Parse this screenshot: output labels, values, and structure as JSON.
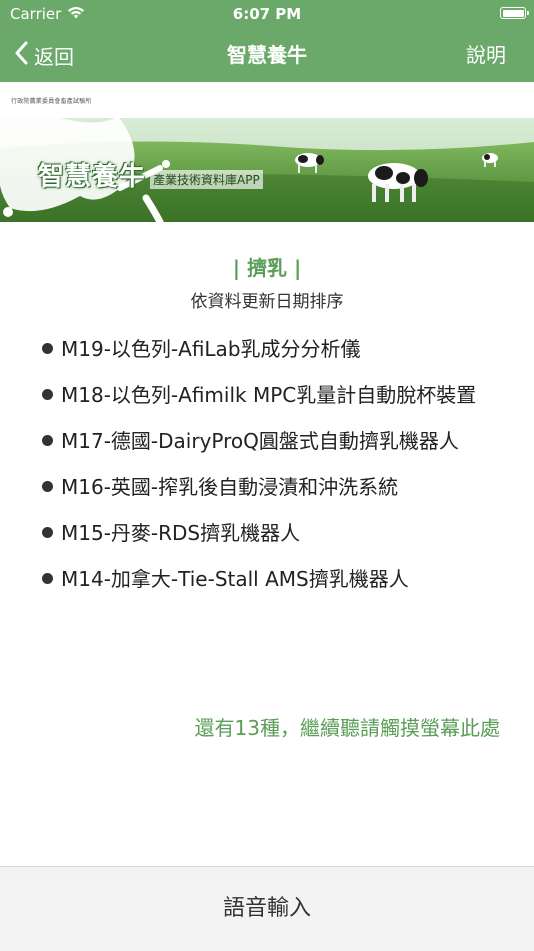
{
  "status_bar": {
    "carrier": "Carrier",
    "time": "6:07 PM",
    "icons": [
      "wifi-icon",
      "battery-icon"
    ]
  },
  "nav": {
    "back_label": "返回",
    "title": "智慧養牛",
    "help_label": "說明",
    "bar_color": "#6aa969"
  },
  "banner": {
    "agency": "行政院農業委員會畜產試驗所",
    "title": "智慧養牛",
    "subtitle": "產業技術資料庫APP"
  },
  "section": {
    "title": "| 擠乳 |",
    "sort_note": "依資料更新日期排序",
    "items": [
      "M19-以色列-AfiLab乳成分分析儀",
      "M18-以色列-Afimilk MPC乳量計自動脫杯裝置",
      "M17-德國-DairyProQ圓盤式自動擠乳機器人",
      "M16-英國-搾乳後自動浸漬和沖洗系統",
      "M15-丹麥-RDS擠乳機器人",
      "M14-加拿大-Tie-Stall AMS擠乳機器人"
    ],
    "more_text": "還有13種，繼續聽請觸摸螢幕此處",
    "accent_color": "#5b9e58"
  },
  "bottom": {
    "voice_input_label": "語音輸入"
  }
}
